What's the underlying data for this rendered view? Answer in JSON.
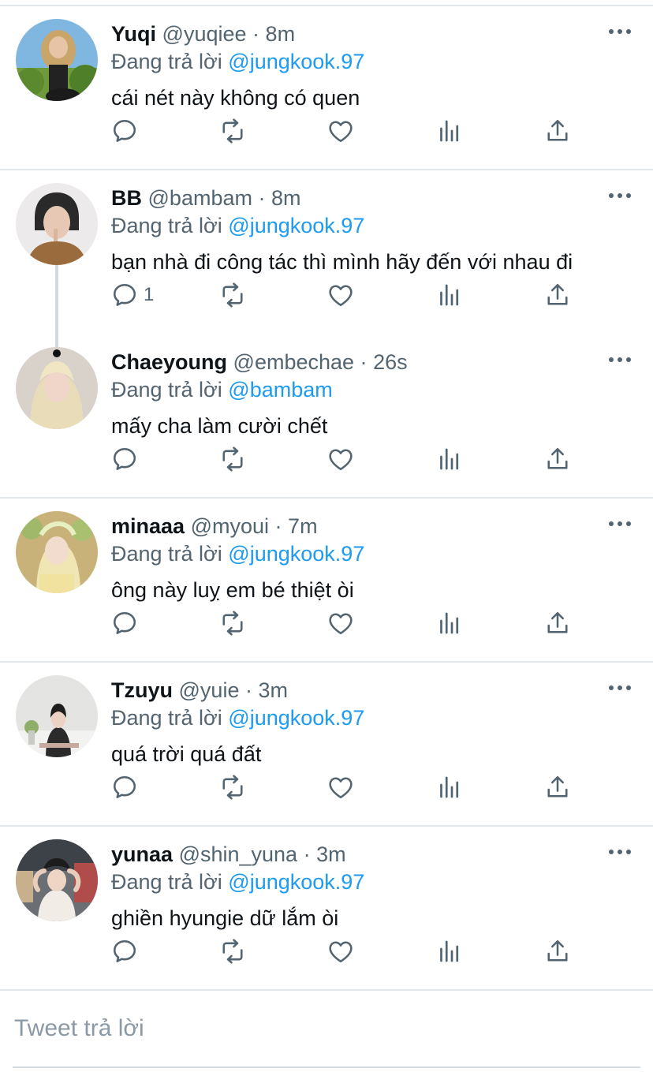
{
  "replies": [
    {
      "name": "Yuqi",
      "handle": "@yuqiee",
      "time": "8m",
      "replying_label": "Đang trả lời",
      "replying_to": "@jungkook.97",
      "text": "cái nét này không có quen",
      "reply_count": ""
    },
    {
      "name": "BB",
      "handle": "@bambam",
      "time": "8m",
      "replying_label": "Đang trả lời",
      "replying_to": "@jungkook.97",
      "text": "bạn nhà đi công tác thì mình hãy đến với nhau đi",
      "reply_count": "1"
    },
    {
      "name": "Chaeyoung",
      "handle": "@embechae",
      "time": "26s",
      "replying_label": "Đang trả lời",
      "replying_to": "@bambam",
      "text": "mấy cha làm cười chết",
      "reply_count": ""
    },
    {
      "name": "minaaa",
      "handle": "@myoui",
      "time": "7m",
      "replying_label": "Đang trả lời",
      "replying_to": "@jungkook.97",
      "text": "ông này luỵ em bé thiệt òi",
      "reply_count": ""
    },
    {
      "name": "Tzuyu",
      "handle": "@yuie",
      "time": "3m",
      "replying_label": "Đang trả lời",
      "replying_to": "@jungkook.97",
      "text": "quá trời quá đất",
      "reply_count": ""
    },
    {
      "name": "yunaa",
      "handle": "@shin_yuna",
      "time": "3m",
      "replying_label": "Đang trả lời",
      "replying_to": "@jungkook.97",
      "text": "ghiền hyungie dữ lắm òi",
      "reply_count": ""
    }
  ],
  "separator": "·",
  "compose": {
    "placeholder": "Tweet trả lời"
  },
  "icons": {
    "reply": "reply-icon",
    "retweet": "retweet-icon",
    "like": "heart-icon",
    "stats": "stats-icon",
    "share": "share-icon",
    "more": "more-icon"
  },
  "colors": {
    "link": "#1d9bf0",
    "secondary": "#536471",
    "text": "#0f1419"
  }
}
